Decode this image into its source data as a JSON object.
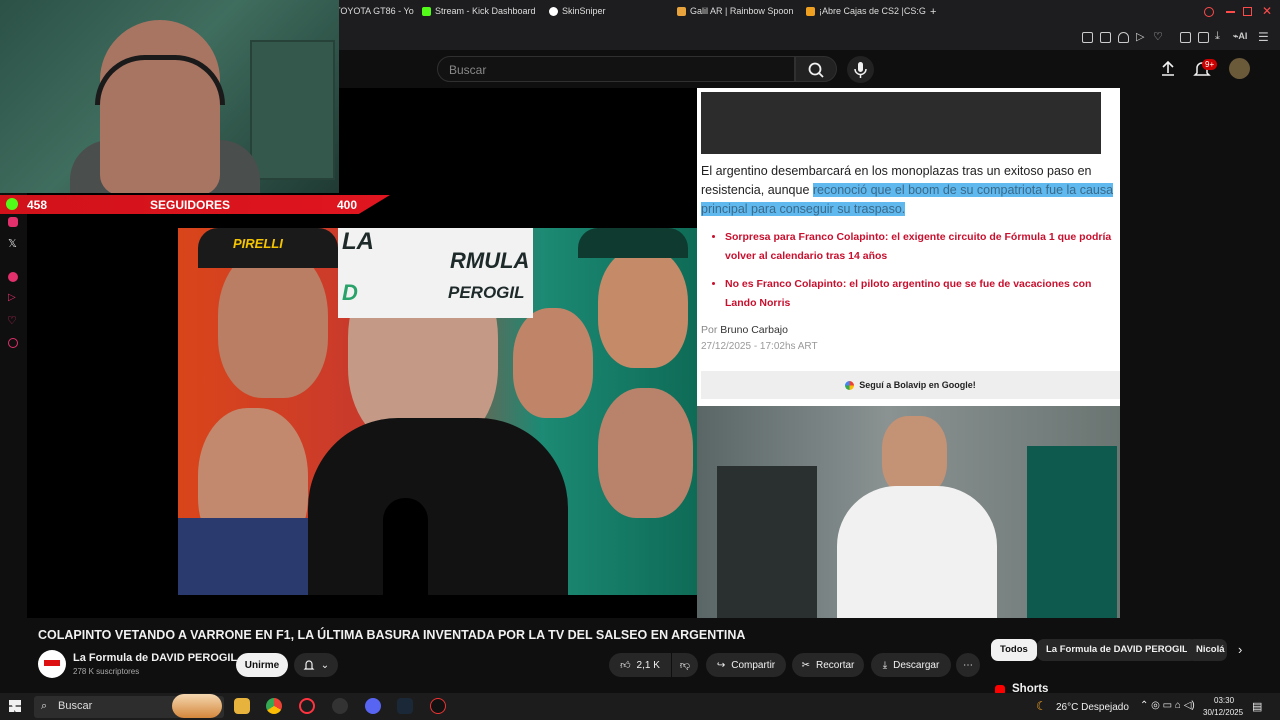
{
  "browser": {
    "tabs": [
      {
        "label": "TOYOTA GT86 - Yo",
        "color": "#ff0000"
      },
      {
        "label": "Stream - Kick Dashboard",
        "color": "#53fc18"
      },
      {
        "label": "SkinSniper",
        "color": "#ffffff"
      },
      {
        "label": "Galil AR | Rainbow Spoon",
        "color": "#e8a33c"
      },
      {
        "label": "¡Abre Cajas de CS2 |CS:G",
        "color": "#f0a020"
      }
    ],
    "new_tab": "+"
  },
  "header": {
    "search_placeholder": "Buscar",
    "notif_badge": "9+"
  },
  "overlay": {
    "followers_current": "458",
    "followers_label": "SEGUIDORES",
    "followers_goal": "400"
  },
  "thumbnail": {
    "logo_line1": "LA",
    "logo_line2": "RMULA",
    "logo_line3": "D",
    "logo_line4": "PEROGIL"
  },
  "article": {
    "paragraph_start": "El argentino desembarcará en los monoplazas tras un exitoso paso en resistencia, aunque ",
    "paragraph_highlight": "reconoció que el boom de su compatriota fue la causa principal para conseguir su traspaso.",
    "links": [
      "Sorpresa para Franco Colapinto: el exigente circuito de Fórmula 1 que podría volver al calendario tras 14 años",
      "No es Franco Colapinto: el piloto argentino que se fue de vacaciones con Lando Norris"
    ],
    "by_label": "Por",
    "author": "Bruno Carbajo",
    "date": "27/12/2025 - 17:02hs ART",
    "google_follow": "Seguí a Bolavip en Google!"
  },
  "video": {
    "title": "COLAPINTO VETANDO A VARRONE EN F1, LA ÚLTIMA BASURA INVENTADA POR LA TV DEL SALSEO EN ARGENTINA",
    "channel": "La Formula de DAVID PEROGIL",
    "subscribers": "278 K suscriptores",
    "join_label": "Unirme",
    "likes": "2,1 K",
    "share_label": "Compartir",
    "clip_label": "Recortar",
    "download_label": "Descargar"
  },
  "chips": [
    "Todos",
    "La Formula de DAVID PEROGIL",
    "Nicolá"
  ],
  "shorts_label": "Shorts",
  "taskbar": {
    "search_label": "Buscar",
    "weather": "26°C Despejado",
    "time": "03:30",
    "date": "30/12/2025"
  },
  "colors": {
    "accent": "#ff0000",
    "highlight": "#5fb8ee",
    "link_red": "#c8102e",
    "follow_bar": "#d1121a"
  }
}
